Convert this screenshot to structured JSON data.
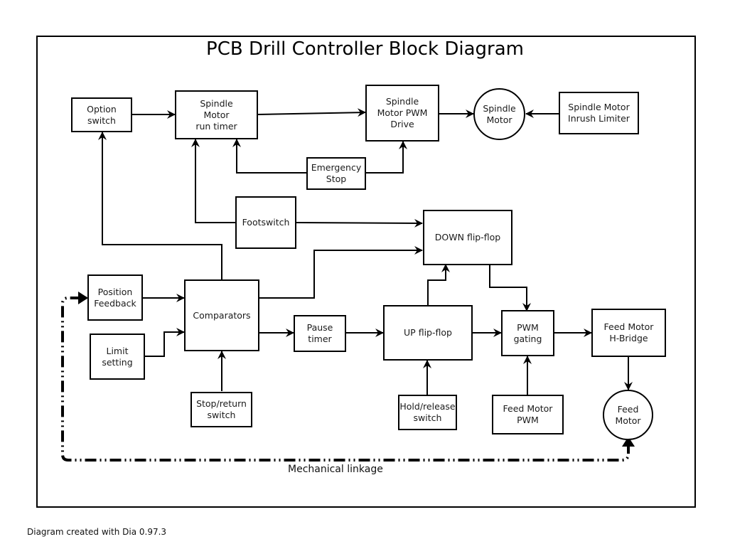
{
  "title": "PCB Drill Controller Block Diagram",
  "footer": "Diagram created with Dia 0.97.3",
  "linkage_label": "Mechanical linkage",
  "blocks": {
    "option_switch": "Option\nswitch",
    "spindle_run_timer": "Spindle\nMotor\nrun timer",
    "spindle_pwm_drive": "Spindle\nMotor PWM\nDrive",
    "spindle_motor": "Spindle\nMotor",
    "inrush_limiter": "Spindle Motor\nInrush Limiter",
    "emergency_stop": "Emergency\nStop",
    "footswitch": "Footswitch",
    "down_flipflop": "DOWN flip-flop",
    "position_feedback": "Position\nFeedback",
    "comparators": "Comparators",
    "limit_setting": "Limit\nsetting",
    "pause_timer": "Pause\ntimer",
    "up_flipflop": "UP flip-flop",
    "pwm_gating": "PWM\ngating",
    "feed_hbridge": "Feed Motor\nH-Bridge",
    "stop_return_switch": "Stop/return\nswitch",
    "hold_release_switch": "Hold/release\nswitch",
    "feed_motor_pwm": "Feed Motor\nPWM",
    "feed_motor": "Feed\nMotor"
  },
  "connections": [
    {
      "from": "Option switch",
      "to": "Spindle Motor run timer"
    },
    {
      "from": "Spindle Motor run timer",
      "to": "Spindle Motor PWM Drive"
    },
    {
      "from": "Spindle Motor PWM Drive",
      "to": "Spindle Motor"
    },
    {
      "from": "Spindle Motor Inrush Limiter",
      "to": "Spindle Motor"
    },
    {
      "from": "Emergency Stop",
      "to": "Spindle Motor run timer"
    },
    {
      "from": "Emergency Stop",
      "to": "Spindle Motor PWM Drive"
    },
    {
      "from": "Footswitch",
      "to": "Spindle Motor run timer"
    },
    {
      "from": "Footswitch",
      "to": "DOWN flip-flop"
    },
    {
      "from": "Comparators",
      "to": "Option switch"
    },
    {
      "from": "Comparators",
      "to": "DOWN flip-flop"
    },
    {
      "from": "Position Feedback",
      "to": "Comparators"
    },
    {
      "from": "Limit setting",
      "to": "Comparators"
    },
    {
      "from": "Stop/return switch",
      "to": "Comparators"
    },
    {
      "from": "Comparators",
      "to": "Pause timer"
    },
    {
      "from": "Pause timer",
      "to": "UP flip-flop"
    },
    {
      "from": "UP flip-flop",
      "to": "DOWN flip-flop"
    },
    {
      "from": "Hold/release switch",
      "to": "UP flip-flop"
    },
    {
      "from": "UP flip-flop",
      "to": "PWM gating"
    },
    {
      "from": "DOWN flip-flop",
      "to": "PWM gating"
    },
    {
      "from": "Feed Motor PWM",
      "to": "PWM gating"
    },
    {
      "from": "PWM gating",
      "to": "Feed Motor H-Bridge"
    },
    {
      "from": "Feed Motor H-Bridge",
      "to": "Feed Motor"
    },
    {
      "from": "Feed Motor",
      "to": "Position Feedback",
      "style": "mechanical linkage"
    }
  ]
}
